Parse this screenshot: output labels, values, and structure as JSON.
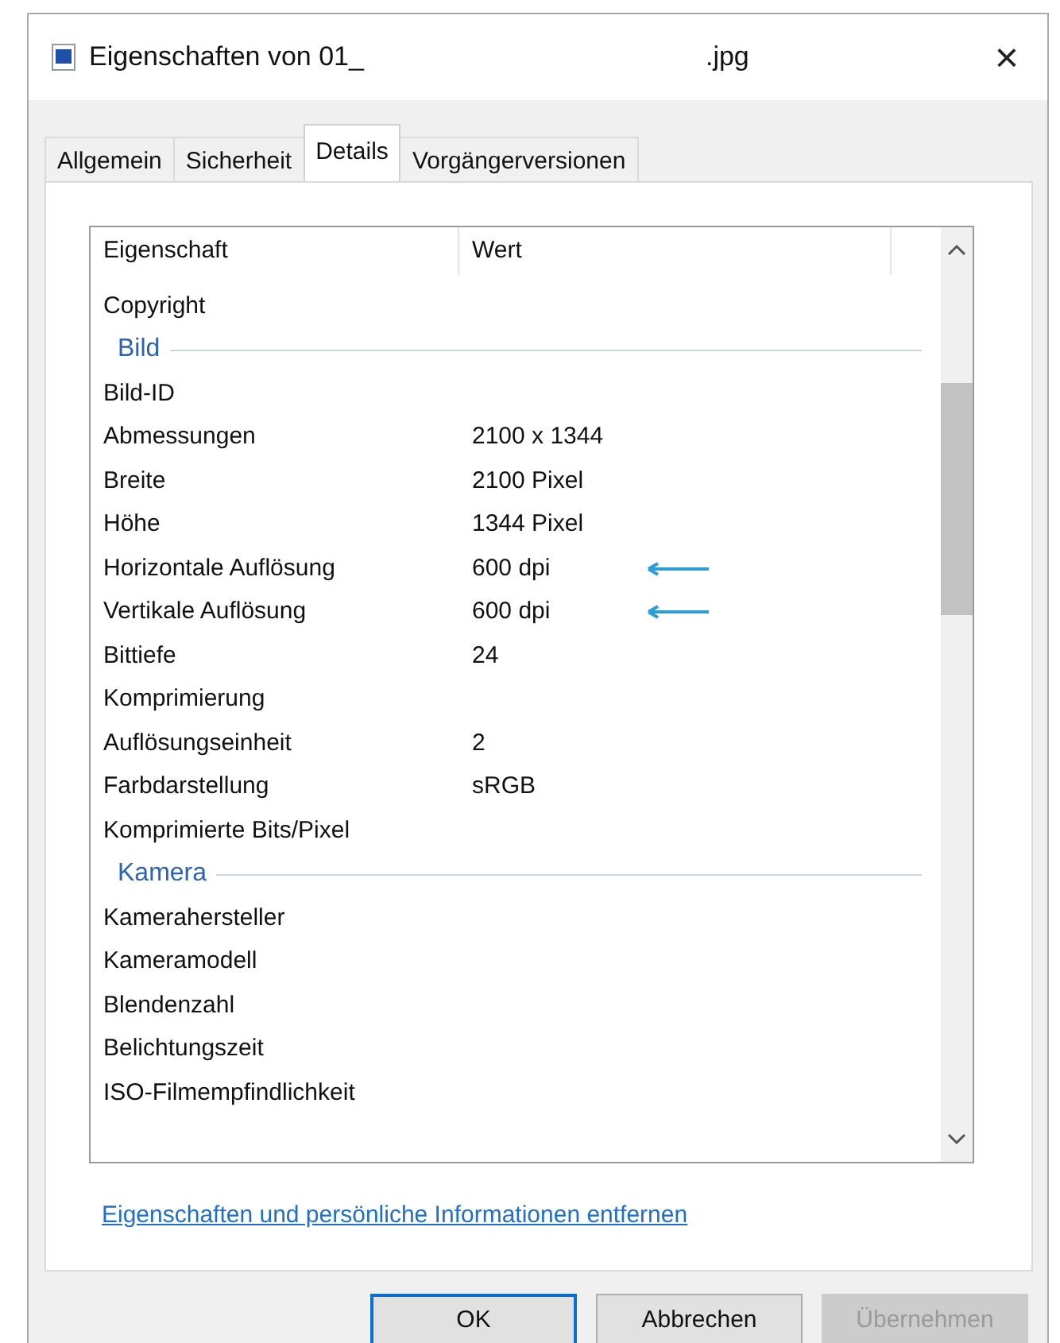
{
  "window": {
    "title_start": "Eigenschaften von 01_",
    "title_end": ".jpg",
    "close": "×"
  },
  "tabs": [
    {
      "label": "Allgemein",
      "selected": false
    },
    {
      "label": "Sicherheit",
      "selected": false
    },
    {
      "label": "Details",
      "selected": true
    },
    {
      "label": "Vorgängerversionen",
      "selected": false
    }
  ],
  "table": {
    "columns": [
      "Eigenschaft",
      "Wert"
    ],
    "rows": [
      {
        "kind": "property",
        "name": "Copyright",
        "arrow": false
      },
      {
        "kind": "group",
        "name": "Bild"
      },
      {
        "kind": "property",
        "name": "Bild-ID",
        "arrow": false
      },
      {
        "kind": "property",
        "name": "Abmessungen",
        "value": "2100 x 1344",
        "arrow": false
      },
      {
        "kind": "property",
        "name": "Breite",
        "value": "2100 Pixel",
        "arrow": false
      },
      {
        "kind": "property",
        "name": "Höhe",
        "value": "1344 Pixel",
        "arrow": false
      },
      {
        "kind": "property",
        "name": "Horizontale Auflösung",
        "value": "600 dpi",
        "arrow": true
      },
      {
        "kind": "property",
        "name": "Vertikale Auflösung",
        "value": "600 dpi",
        "arrow": true
      },
      {
        "kind": "property",
        "name": "Bittiefe",
        "value": "24",
        "arrow": false
      },
      {
        "kind": "property",
        "name": "Komprimierung",
        "arrow": false
      },
      {
        "kind": "property",
        "name": "Auflösungseinheit",
        "value": "2",
        "arrow": false
      },
      {
        "kind": "property",
        "name": "Farbdarstellung",
        "value": "sRGB",
        "arrow": false
      },
      {
        "kind": "property",
        "name": "Komprimierte Bits/Pixel",
        "arrow": false
      },
      {
        "kind": "group",
        "name": "Kamera"
      },
      {
        "kind": "property",
        "name": "Kamerahersteller",
        "arrow": false
      },
      {
        "kind": "property",
        "name": "Kameramodell",
        "arrow": false
      },
      {
        "kind": "property",
        "name": "Blendenzahl",
        "arrow": false
      },
      {
        "kind": "property",
        "name": "Belichtungszeit",
        "arrow": false
      },
      {
        "kind": "property",
        "name": "ISO-Filmempfindlichkeit",
        "arrow": false
      }
    ]
  },
  "link": "Eigenschaften und persönliche Informationen entfernen",
  "buttons": [
    {
      "label": "OK",
      "default": true,
      "disabled": false
    },
    {
      "label": "Abbrechen",
      "default": false,
      "disabled": false
    },
    {
      "label": "Übernehmen",
      "default": false,
      "disabled": true
    }
  ]
}
